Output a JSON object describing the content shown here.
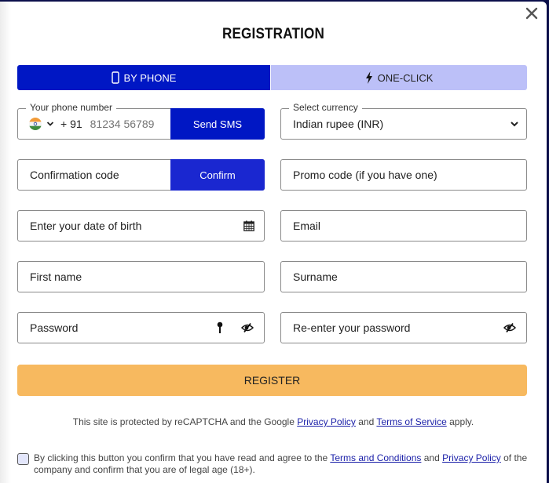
{
  "modal": {
    "title": "REGISTRATION",
    "close_icon": "close-icon"
  },
  "tabs": [
    {
      "label": "BY PHONE",
      "icon": "mobile-phone-icon",
      "active": true
    },
    {
      "label": "ONE-CLICK",
      "icon": "lightning-bolt-icon",
      "active": false
    }
  ],
  "form": {
    "phone": {
      "legend": "Your phone number",
      "country_flag": "india-flag-icon",
      "prefix": "+ 91",
      "placeholder": "81234 56789",
      "send_button": "Send SMS"
    },
    "currency": {
      "legend": "Select currency",
      "selected": "Indian rupee (INR)"
    },
    "confirmation_code": {
      "placeholder": "Confirmation code",
      "button": "Confirm"
    },
    "promo_code": {
      "placeholder": "Promo code (if you have one)"
    },
    "date_of_birth": {
      "placeholder": "Enter your date of birth",
      "icon": "calendar-icon"
    },
    "email": {
      "placeholder": "Email"
    },
    "first_name": {
      "placeholder": "First name"
    },
    "surname": {
      "placeholder": "Surname"
    },
    "password": {
      "placeholder": "Password",
      "icons": [
        "key-icon",
        "eye-slash-icon"
      ]
    },
    "password_confirm": {
      "placeholder": "Re-enter your password",
      "icons": [
        "eye-slash-icon"
      ]
    },
    "register_button": "REGISTER"
  },
  "footer": {
    "recaptcha_prefix": "This site is protected by reCAPTCHA and the Google ",
    "privacy_policy": "Privacy Policy",
    "and": " and ",
    "terms_of_service": "Terms of Service",
    "recaptcha_suffix": " apply.",
    "consent_prefix": "By clicking this button you confirm that you have read and agree to the ",
    "terms_and_conditions": "Terms and Conditions",
    "consent_and": " and ",
    "consent_privacy_policy": "Privacy Policy",
    "consent_suffix": " of the company and confirm that you are of legal age (18+).",
    "consent_checked": false
  },
  "colors": {
    "primary": "#0017c4",
    "confirm_button": "#1a27d0",
    "tab_inactive": "#bcc0f8",
    "register": "#f7b95f",
    "link": "#1a1fa8",
    "backdrop": "#0b0f4a"
  }
}
